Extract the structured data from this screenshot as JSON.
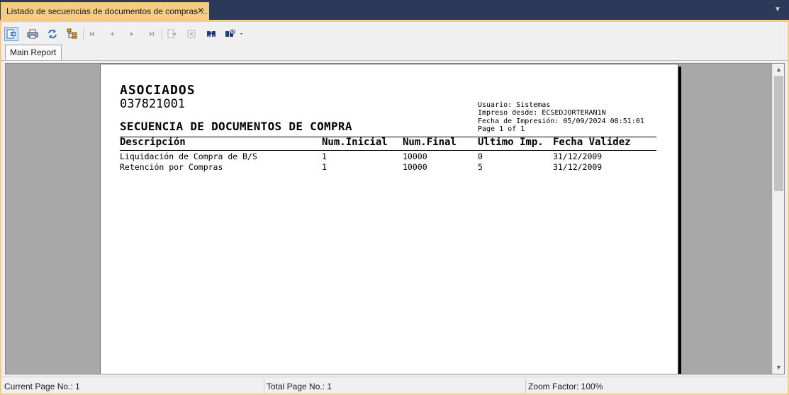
{
  "window": {
    "tab_title": "Listado de secuencias de documentos de compras ::.",
    "close_glyph": "✕",
    "dropdown_glyph": "▼"
  },
  "toolbar": {
    "buttons": [
      {
        "name": "export-report-icon"
      },
      {
        "name": "print-icon"
      },
      {
        "name": "refresh-icon"
      },
      {
        "name": "group-tree-icon"
      },
      {
        "name": "first-page-icon"
      },
      {
        "name": "previous-page-icon"
      },
      {
        "name": "next-page-icon"
      },
      {
        "name": "last-page-icon"
      },
      {
        "name": "go-to-page-icon"
      },
      {
        "name": "stop-icon"
      },
      {
        "name": "search-binoculars-icon"
      },
      {
        "name": "zoom-icon"
      }
    ]
  },
  "report_tabs": {
    "main": "Main Report"
  },
  "report": {
    "company": "ASOCIADOS",
    "ruc": "037821001",
    "title": "SECUENCIA DE DOCUMENTOS DE COMPRA",
    "meta": {
      "usuario": "Usuario: Sistemas",
      "impreso_desde": "Impreso desde: ECSEDJORTERAN1N",
      "fecha_impresion": "Fecha de Impresión: 05/09/2024 08:51:01",
      "page": "Page 1 of 1"
    },
    "columns": {
      "descripcion": "Descripción",
      "num_inicial": "Num.Inicial",
      "num_final": "Num.Final",
      "ultimo_imp": "Ultimo Imp.",
      "fecha_validez": "Fecha Validez"
    },
    "rows": [
      {
        "descripcion": "Liquidación de Compra de B/S",
        "num_inicial": "1",
        "num_final": "10000",
        "ultimo_imp": "0",
        "fecha_validez": "31/12/2009"
      },
      {
        "descripcion": "Retención por Compras",
        "num_inicial": "1",
        "num_final": "10000",
        "ultimo_imp": "5",
        "fecha_validez": "31/12/2009"
      }
    ]
  },
  "statusbar": {
    "current_page": "Current Page No.: 1",
    "total_page": "Total Page No.: 1",
    "zoom": "Zoom Factor: 100%"
  },
  "colors": {
    "active_tab": "#f5cc84",
    "chrome_background": "#2b3a58",
    "viewer_background": "#a8a8a8"
  }
}
